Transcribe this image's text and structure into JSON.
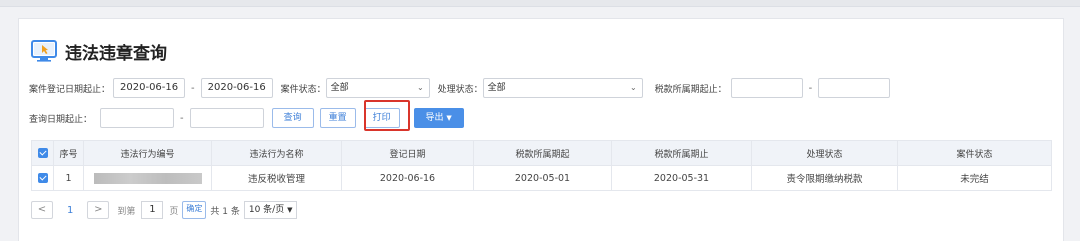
{
  "title": "违法违章查询",
  "filters": {
    "reg_date_label": "案件登记日期起止：",
    "reg_date_from": "2020-06-16",
    "reg_date_sep": "-",
    "reg_date_to": "2020-06-16",
    "case_status_label": "案件状态：",
    "case_status_value": "全部",
    "process_status_label": "处理状态：",
    "process_status_value": "全部",
    "tax_period_label": "税款所属期起止：",
    "tax_period_from": "",
    "tax_period_sep": "-",
    "tax_period_to": "",
    "query_date_label": "查询日期起止：",
    "query_date_from": "",
    "query_date_sep": "-",
    "query_date_to": ""
  },
  "actions": {
    "query": "查询",
    "reset": "重置",
    "print": "打印",
    "export": "导出"
  },
  "table": {
    "headers": [
      "序号",
      "违法行为编号",
      "违法行为名称",
      "登记日期",
      "税款所属期起",
      "税款所属期止",
      "处理状态",
      "案件状态"
    ],
    "rows": [
      {
        "index": "1",
        "violation_no": "",
        "violation_name": "违反税收管理",
        "reg_date": "2020-06-16",
        "period_start": "2020-05-01",
        "period_end": "2020-05-31",
        "process_status": "责令限期缴纳税款",
        "case_status": "未完结"
      }
    ]
  },
  "pager": {
    "prev": "<",
    "current": "1",
    "next": ">",
    "goto_label": "到第",
    "goto_value": "1",
    "page_unit": "页",
    "confirm": "确定",
    "total": "共 1 条",
    "page_size": "10 条/页"
  },
  "colors": {
    "accent": "#4a8fe7",
    "highlight": "#d9352b"
  },
  "icons": {
    "title_icon": "monitor-cursor-icon",
    "dropdown": "chevron-down-icon"
  }
}
